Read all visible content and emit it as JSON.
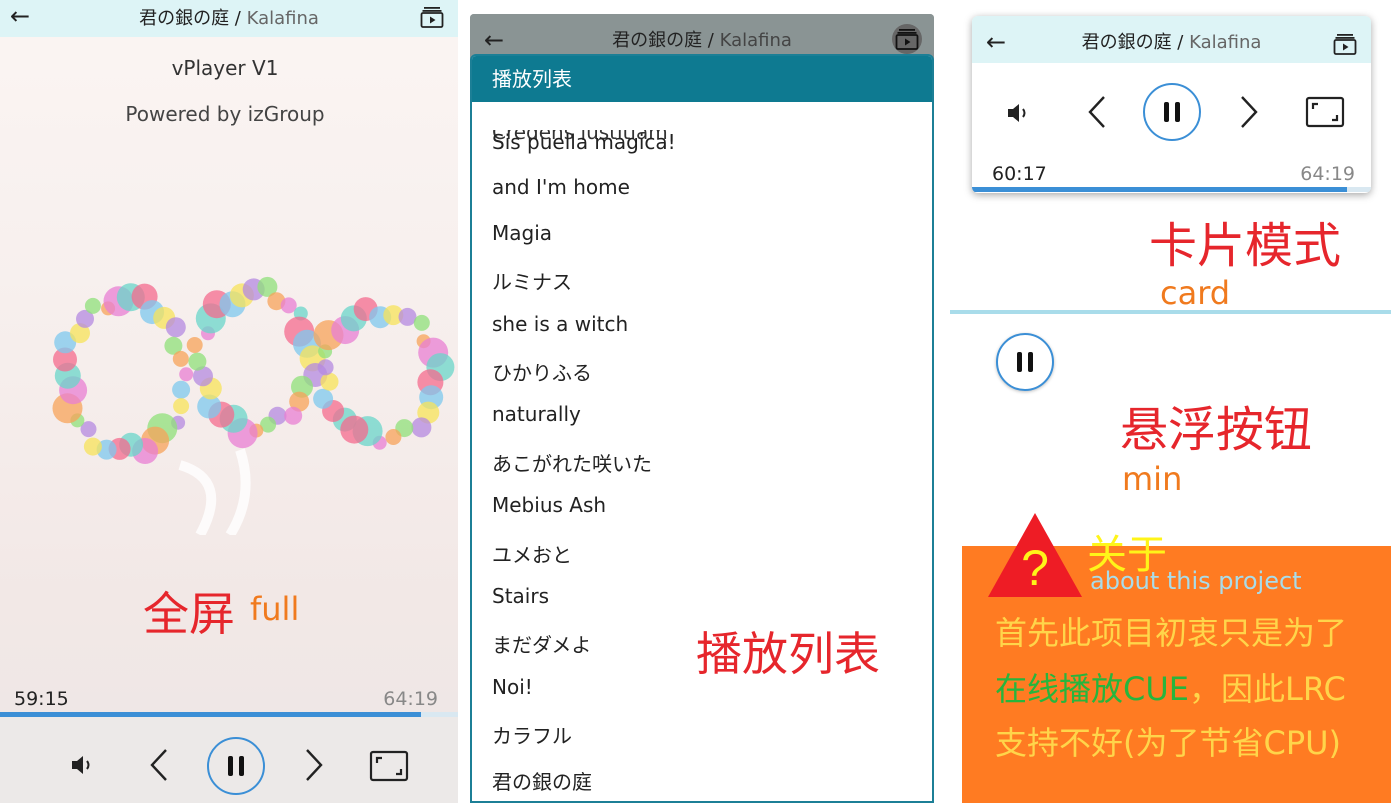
{
  "player": {
    "song_title": "君の銀の庭",
    "separator": " / ",
    "artist": "Kalafina",
    "back_icon": "back-arrow-icon",
    "playlist_icon": "playlist-icon"
  },
  "full": {
    "app_name": "vPlayer V1",
    "powered_by": "Powered by izGroup",
    "mode_label_cn": "全屏",
    "mode_label_en": "full",
    "current_time": "59:15",
    "total_time": "64:19",
    "progress": 0.92
  },
  "playlist": {
    "header": "播放列表",
    "partial_item": "Credens justitiam",
    "items": [
      "Sis puella magica!",
      "and I'm home",
      "Magia",
      "ルミナス",
      "she is a witch",
      "ひかりふる",
      "naturally",
      "あこがれた咲いた",
      "Mebius Ash",
      "ユメおと",
      "Stairs",
      "まだダメよ",
      "Noi!",
      "カラフル",
      "君の銀の庭"
    ],
    "mode_label_cn": "播放列表"
  },
  "card": {
    "current_time": "60:17",
    "total_time": "64:19",
    "progress": 0.94,
    "mode_label_cn": "卡片模式",
    "mode_label_en": "card"
  },
  "min": {
    "mode_label_cn": "悬浮按钮",
    "mode_label_en": "min"
  },
  "about": {
    "title": "关于",
    "subtitle": "about this project",
    "line1": "首先此项目初衷只是为了",
    "line2_green": "在线播放CUE",
    "line2_rest": "，因此LRC",
    "line3": "支持不好(为了节省CPU)"
  },
  "colors": {
    "accent": "#3b8fd6",
    "header_bg": "#ddf4f6",
    "playlist_header": "#0e7a91",
    "label_red": "#e6262c",
    "label_orange": "#f07a1e",
    "about_bg": "#ff7b22"
  }
}
